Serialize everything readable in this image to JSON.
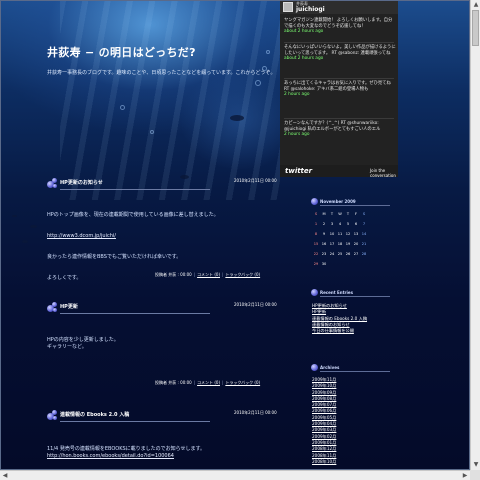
{
  "blog": {
    "title": "井荻寿 − の明日はどっちだ?",
    "description": "井荻寿一事務長のブログです。趣味のことや、日頃思ったことなどを綴っています。これからどうぞ。"
  },
  "posts": [
    {
      "title": "HP更新のお知らせ",
      "date": "2010年2月11日 00:00",
      "body": [
        "HPのトップ画像を、現在の連載期間で使用している画像に差し替えました。",
        "http://www3.dcom.jp/juichi/",
        "良かったら連作情報をBBSでもご覧いただければ幸いです。",
        "よろしくです。"
      ],
      "meta": {
        "posted_by": "投稿者 井荻 : 00:00",
        "comments": "コメント (0)",
        "trackbacks": "トラックバック (0)"
      }
    },
    {
      "title": "HP更新",
      "date": "2010年2月11日 00:00",
      "body": [
        "HPの内容を少し更新しました。",
        "ギャラリーなど。"
      ],
      "meta": {
        "posted_by": "投稿者 井荻 : 00:00",
        "comments": "コメント (0)",
        "trackbacks": "トラックバック (0)"
      }
    },
    {
      "title": "連載情報の Ebooks 2.0 入稿",
      "date": "2010年2月11日 00:00",
      "body": [
        "11/4 発売号の連載情報をEBOOKSに載りましたのでお知らせします。",
        "http://hon.books.com/ebooks/detail.do?id=100064"
      ]
    }
  ],
  "twitter": {
    "name": "井荻寿",
    "handle": "juichiogi",
    "tweets": [
      {
        "text": "ヤングマガジン連載開始！ よろしくお願いします。自分で描くのも大変なのでどうぞ応援してね！",
        "meta": "about 2 hours ago"
      },
      {
        "text": "そんなにいっぱいいらないよ。美しい作品が描けるようにしたいって思ってます。 RT @sabonz: 連載頑張ってね",
        "meta": "about 2 hours ago"
      },
      {
        "text": "あっちに出てくるキャラはお気に入りです。ぜひ見てね RT @salohoke: アキバ系二組の登場人物も",
        "meta": "2 hours ago"
      },
      {
        "text": "カピーンなんですか？(^_^) RT @shunwariiko: @juichiogi 私のエルボーがとてもすごい人のエル",
        "meta": "2 hours ago"
      }
    ],
    "logo": "twitter",
    "join": "Join the conversation"
  },
  "calendar": {
    "title": "November 2009",
    "weekdays": [
      "S",
      "M",
      "T",
      "W",
      "T",
      "F",
      "S"
    ],
    "weeks": [
      [
        "1",
        "2",
        "3",
        "4",
        "5",
        "6",
        "7"
      ],
      [
        "8",
        "9",
        "10",
        "11",
        "12",
        "13",
        "14"
      ],
      [
        "15",
        "16",
        "17",
        "18",
        "19",
        "20",
        "21"
      ],
      [
        "22",
        "23",
        "24",
        "25",
        "26",
        "27",
        "28"
      ],
      [
        "29",
        "30",
        "",
        "",
        "",
        "",
        ""
      ]
    ]
  },
  "recent_entries": {
    "title": "Recent Entries",
    "items": [
      "HP更新のお知らせ",
      "HP更新",
      "連載情報の Ebooks 2.0 入稿",
      "連載情報のお知らせ",
      "今日の仕事情報を公開"
    ]
  },
  "archives": {
    "title": "Archives",
    "items": [
      "2009年11月",
      "2009年10月",
      "2009年09月",
      "2009年08月",
      "2009年07月",
      "2009年06月",
      "2009年05月",
      "2009年04月",
      "2009年03月",
      "2009年02月",
      "2009年01月",
      "2008年12月",
      "2008年11月",
      "2008年10月"
    ]
  }
}
